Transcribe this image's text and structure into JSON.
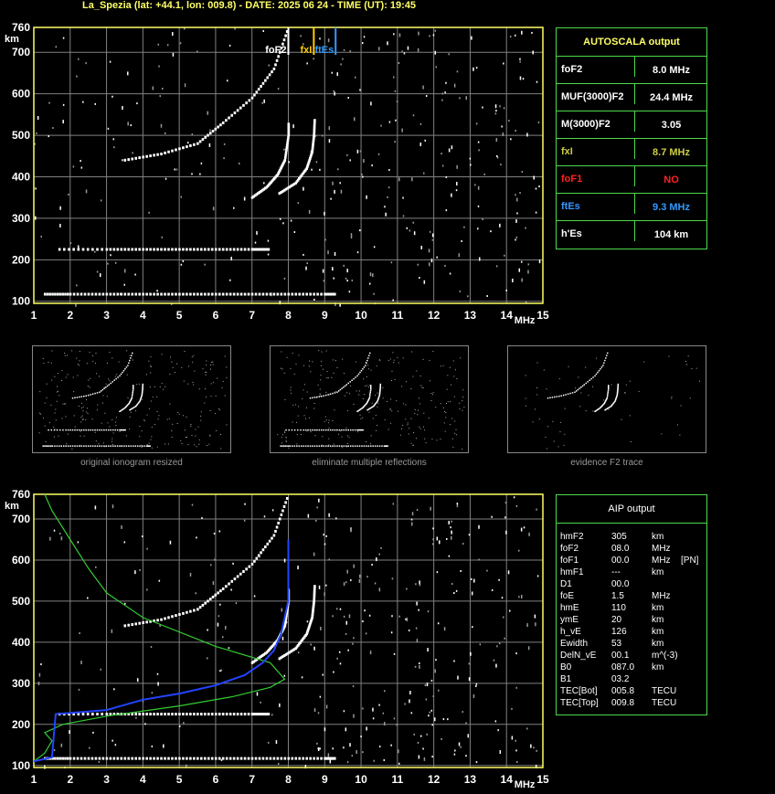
{
  "header": "La_Spezia (lat: +44.1, lon: 009.8) - DATE: 2025 06 24 - TIME (UT): 19:45",
  "colors": {
    "grid": "#808080",
    "frame": "#ffff66",
    "green": "#33cc33",
    "blue": "#2244ff",
    "yellow": "#ffcc00",
    "lightblue": "#3399ff",
    "red": "#ff2222",
    "olive": "#cccc44"
  },
  "chart_data": [
    {
      "type": "scatter",
      "title": "",
      "xlabel": "MHz",
      "ylabel": "km",
      "xlim": [
        1,
        15
      ],
      "ylim": [
        95,
        760
      ],
      "x_ticks": [
        "1",
        "2",
        "3",
        "4",
        "5",
        "6",
        "7",
        "8",
        "9",
        "10",
        "11",
        "12",
        "13",
        "14",
        "15"
      ],
      "y_ticks": [
        "100",
        "200",
        "300",
        "400",
        "500",
        "600",
        "700",
        "760"
      ],
      "grid": true,
      "traces": [
        {
          "name": "E layer",
          "points": [
            [
              1.3,
              117
            ],
            [
              2,
              117
            ],
            [
              3,
              117
            ],
            [
              4,
              117
            ],
            [
              5,
              117
            ],
            [
              6,
              117
            ],
            [
              7,
              117
            ],
            [
              8,
              117
            ],
            [
              9,
              117
            ],
            [
              9.3,
              117
            ]
          ]
        },
        {
          "name": "Es",
          "points": [
            [
              1.7,
              225
            ],
            [
              3,
              225
            ],
            [
              4,
              225
            ],
            [
              5,
              225
            ],
            [
              6,
              225
            ],
            [
              7,
              225
            ],
            [
              7.5,
              225
            ]
          ]
        },
        {
          "name": "F2 o-trace",
          "points": [
            [
              7.0,
              350
            ],
            [
              7.4,
              375
            ],
            [
              7.7,
              405
            ],
            [
              7.9,
              440
            ],
            [
              8.0,
              500
            ],
            [
              8.0,
              530
            ]
          ]
        },
        {
          "name": "F2 x-trace",
          "points": [
            [
              7.75,
              360
            ],
            [
              8.2,
              385
            ],
            [
              8.5,
              420
            ],
            [
              8.65,
              460
            ],
            [
              8.7,
              500
            ],
            [
              8.72,
              540
            ]
          ]
        },
        {
          "name": "F2 2nd hop",
          "points": [
            [
              3.5,
              440
            ],
            [
              4.5,
              455
            ],
            [
              5.5,
              480
            ],
            [
              6.2,
              530
            ],
            [
              7,
              590
            ],
            [
              7.6,
              660
            ],
            [
              8.0,
              760
            ]
          ]
        }
      ],
      "markers": [
        {
          "label": "foF2",
          "x": 8.0,
          "color": "#ffffff"
        },
        {
          "label": "fxI",
          "x": 8.7,
          "color": "#ffcc00"
        },
        {
          "label": "ftEs",
          "x": 9.3,
          "color": "#3399ff"
        }
      ]
    },
    {
      "type": "line",
      "title": "",
      "xlabel": "MHz",
      "ylabel": "km",
      "xlim": [
        1,
        15
      ],
      "ylim": [
        95,
        760
      ],
      "x_ticks": [
        "1",
        "2",
        "3",
        "4",
        "5",
        "6",
        "7",
        "8",
        "9",
        "10",
        "11",
        "12",
        "13",
        "14",
        "15"
      ],
      "y_ticks": [
        "100",
        "200",
        "300",
        "400",
        "500",
        "600",
        "700",
        "760"
      ],
      "grid": true,
      "series": [
        {
          "color": "green",
          "points": [
            [
              1.0,
              110
            ],
            [
              1.3,
              130
            ],
            [
              1.5,
              160
            ],
            [
              1.3,
              180
            ],
            [
              1.8,
              200
            ],
            [
              3,
              220
            ],
            [
              5,
              245
            ],
            [
              6.5,
              268
            ],
            [
              7.5,
              290
            ],
            [
              7.9,
              310
            ],
            [
              7.5,
              350
            ],
            [
              6,
              390
            ],
            [
              4,
              460
            ],
            [
              3,
              520
            ],
            [
              2.5,
              580
            ],
            [
              2,
              650
            ],
            [
              1.5,
              720
            ],
            [
              1.3,
              760
            ]
          ]
        },
        {
          "color": "blue",
          "points": [
            [
              1.0,
              110
            ],
            [
              1.5,
              120
            ],
            [
              1.6,
              225
            ],
            [
              3,
              235
            ],
            [
              4,
              260
            ],
            [
              5,
              275
            ],
            [
              6,
              295
            ],
            [
              6.8,
              320
            ],
            [
              7.3,
              350
            ],
            [
              7.6,
              380
            ],
            [
              7.8,
              420
            ],
            [
              7.9,
              460
            ],
            [
              8.0,
              500
            ],
            [
              8.0,
              600
            ],
            [
              8.0,
              650
            ]
          ]
        }
      ]
    }
  ],
  "autoscala": {
    "title": "AUTOSCALA output",
    "rows": [
      {
        "k": "foF2",
        "v": "8.0 MHz",
        "kc": "#ffffff",
        "vc": "#ffffff"
      },
      {
        "k": "MUF(3000)F2",
        "v": "24.4 MHz",
        "kc": "#ffffff",
        "vc": "#ffffff"
      },
      {
        "k": "M(3000)F2",
        "v": "3.05",
        "kc": "#ffffff",
        "vc": "#ffffff"
      },
      {
        "k": "fxI",
        "v": "8.7 MHz",
        "kc": "#cccc44",
        "vc": "#cccc44"
      },
      {
        "k": "foF1",
        "v": "NO",
        "kc": "#ff2222",
        "vc": "#ff2222"
      },
      {
        "k": "ftEs",
        "v": "9.3 MHz",
        "kc": "#3399ff",
        "vc": "#3399ff"
      },
      {
        "k": "h'Es",
        "v": "104     km",
        "kc": "#ffffff",
        "vc": "#ffffff"
      }
    ]
  },
  "thumbs": {
    "t1": "original ionogram resized",
    "t2": "eliminate multiple reflections",
    "t3": "evidence F2 trace"
  },
  "aip": {
    "title": "AIP output",
    "rows": [
      [
        "hmF2",
        "305",
        "km",
        ""
      ],
      [
        "foF2",
        "08.0",
        "MHz",
        ""
      ],
      [
        "foF1",
        "00.0",
        "MHz",
        "[PN]"
      ],
      [
        "hmF1",
        "---",
        "km",
        ""
      ],
      [
        "D1",
        "00.0",
        "",
        ""
      ],
      [
        "foE",
        "1.5",
        "MHz",
        ""
      ],
      [
        "hmE",
        "110",
        "km",
        ""
      ],
      [
        "ymE",
        "20",
        "km",
        ""
      ],
      [
        "h_vE",
        "126",
        "km",
        ""
      ],
      [
        "Ewidth",
        "53",
        "km",
        ""
      ],
      [
        "DelN_vE",
        "00.1",
        "m^(-3)",
        ""
      ],
      [
        "B0",
        "087.0",
        "km",
        ""
      ],
      [
        "B1",
        "03.2",
        "",
        ""
      ],
      [
        "TEC[Bot]",
        "005.8",
        "TECU",
        ""
      ],
      [
        "TEC[Top]",
        "009.8",
        "TECU",
        ""
      ]
    ]
  }
}
